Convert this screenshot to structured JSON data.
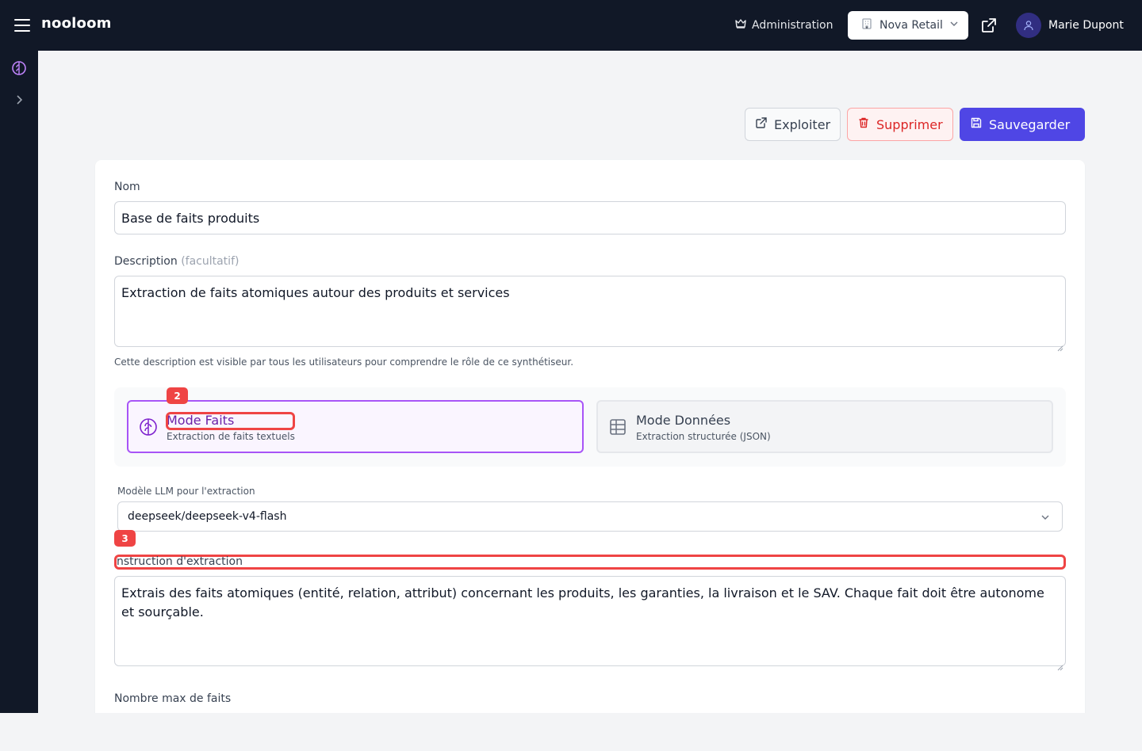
{
  "app": {
    "brand": "nooloom",
    "admin_label": "Administration",
    "org_name": "Nova Retail",
    "user_name": "Marie Dupont"
  },
  "toolbar": {
    "exploit_label": "Exploiter",
    "delete_label": "Supprimer",
    "save_label": "Sauvegarder"
  },
  "form": {
    "name_label": "Nom",
    "name_value": "Base de faits produits",
    "description_label": "Description",
    "description_optional": "(facultatif)",
    "description_value": "Extraction de faits atomiques autour des produits et services",
    "description_help": "Cette description est visible par tous les utilisateurs pour comprendre le rôle de ce synthétiseur.",
    "modes": [
      {
        "title": "Mode Faits",
        "subtitle": "Extraction de faits textuels",
        "icon": "brain-icon",
        "selected": true
      },
      {
        "title": "Mode Données",
        "subtitle": "Extraction structurée (JSON)",
        "icon": "table-icon",
        "selected": false
      }
    ],
    "model_label": "Modèle LLM pour l'extraction",
    "model_value": "deepseek/deepseek-v4-flash",
    "instruction_label": "nstruction d'extraction",
    "instruction_value": "Extrais des faits atomiques (entité, relation, attribut) concernant les produits, les garanties, la livraison et le SAV. Chaque fait doit être autonome et sourçable.",
    "max_facts_label": "Nombre max de faits"
  },
  "annotations": {
    "badge_2": "2",
    "badge_3": "3"
  },
  "colors": {
    "topbar": "#111827",
    "primary": "#4f46e5",
    "danger": "#dc2626",
    "mode_active": "#a855f7",
    "highlight": "#ef4444"
  }
}
